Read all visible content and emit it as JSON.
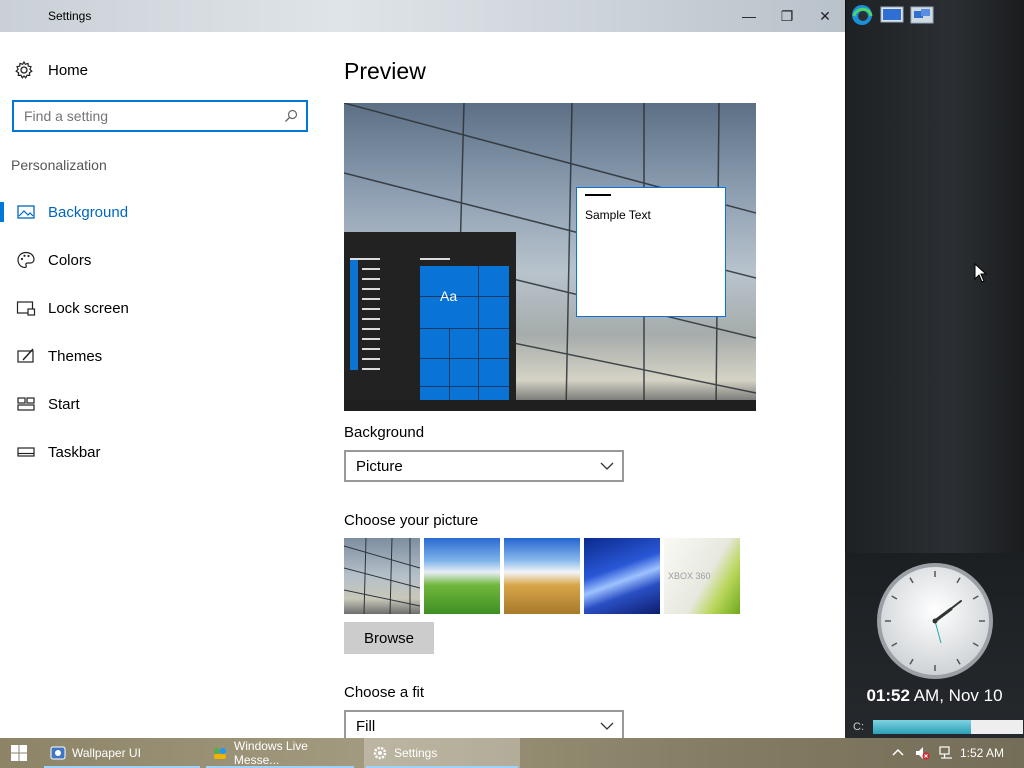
{
  "window": {
    "title": "Settings",
    "minimize": "—",
    "maximize": "❐",
    "close": "✕"
  },
  "sidebar": {
    "home": "Home",
    "search_placeholder": "Find a setting",
    "section": "Personalization",
    "items": [
      {
        "label": "Background",
        "icon": "picture-icon",
        "active": true
      },
      {
        "label": "Colors",
        "icon": "palette-icon"
      },
      {
        "label": "Lock screen",
        "icon": "lock-screen-icon"
      },
      {
        "label": "Themes",
        "icon": "themes-icon"
      },
      {
        "label": "Start",
        "icon": "start-icon"
      },
      {
        "label": "Taskbar",
        "icon": "taskbar-icon"
      }
    ]
  },
  "main": {
    "title": "Preview",
    "preview": {
      "sample_text": "Sample Text",
      "tile_text": "Aa"
    },
    "background_label": "Background",
    "background_value": "Picture",
    "choose_picture_label": "Choose your picture",
    "thumbnails": [
      "glass-building",
      "bliss-hill",
      "wheat-field",
      "blue-streaks",
      "xbox-360"
    ],
    "thumb_brand": "XBOX 360",
    "browse_label": "Browse",
    "fit_label": "Choose a fit",
    "fit_value": "Fill"
  },
  "gadget": {
    "time": "01:52",
    "suffix": " AM, Nov 10",
    "disk_label": "C:",
    "disk_used_fraction": 0.65
  },
  "taskbar": {
    "items": [
      {
        "label": "Wallpaper UI",
        "icon": "wallpaper-ui-icon"
      },
      {
        "label": "Windows Live Messe...",
        "icon": "messenger-icon"
      },
      {
        "label": "Settings",
        "icon": "gear-icon",
        "active": true
      }
    ],
    "time": "1:52 AM"
  },
  "colors": {
    "accent": "#0078d7",
    "tile": "#0a74d6"
  }
}
